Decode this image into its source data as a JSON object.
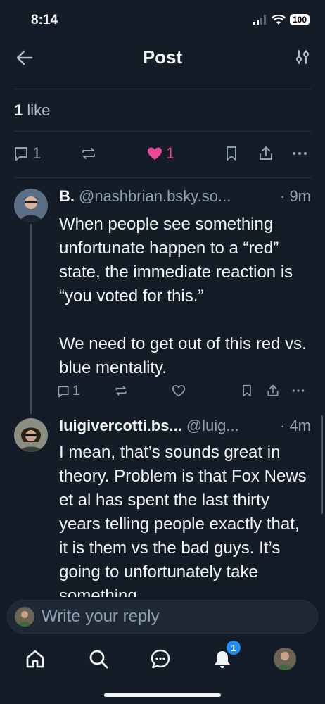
{
  "status": {
    "time": "8:14",
    "battery": "100"
  },
  "header": {
    "title": "Post"
  },
  "likes": {
    "count": "1",
    "label": "like"
  },
  "main_actions": {
    "reply_count": "1",
    "like_count": "1"
  },
  "replies": [
    {
      "name": "B.",
      "handle": "@nashbrian.bsky.so...",
      "time": "· 9m",
      "text": "When people see something unfortunate happen to a “red” state, the immediate reaction is “you voted for this.”\n\nWe need to get out of this red vs. blue mentality.",
      "reply_count": "1"
    },
    {
      "name": "luigivercotti.bs...",
      "handle": "@luig...",
      "time": "· 4m",
      "text": "I mean, that’s sounds great in theory. Problem is that Fox News et al has spent the last thirty years telling people exactly that, it is them vs the bad guys. It’s going to unfortunately take something"
    }
  ],
  "composer": {
    "placeholder": "Write your reply"
  },
  "tabbar": {
    "notifications_badge": "1"
  },
  "colors": {
    "background": "#141d27",
    "accent_like": "#ec4899",
    "badge": "#1d8cf8"
  }
}
